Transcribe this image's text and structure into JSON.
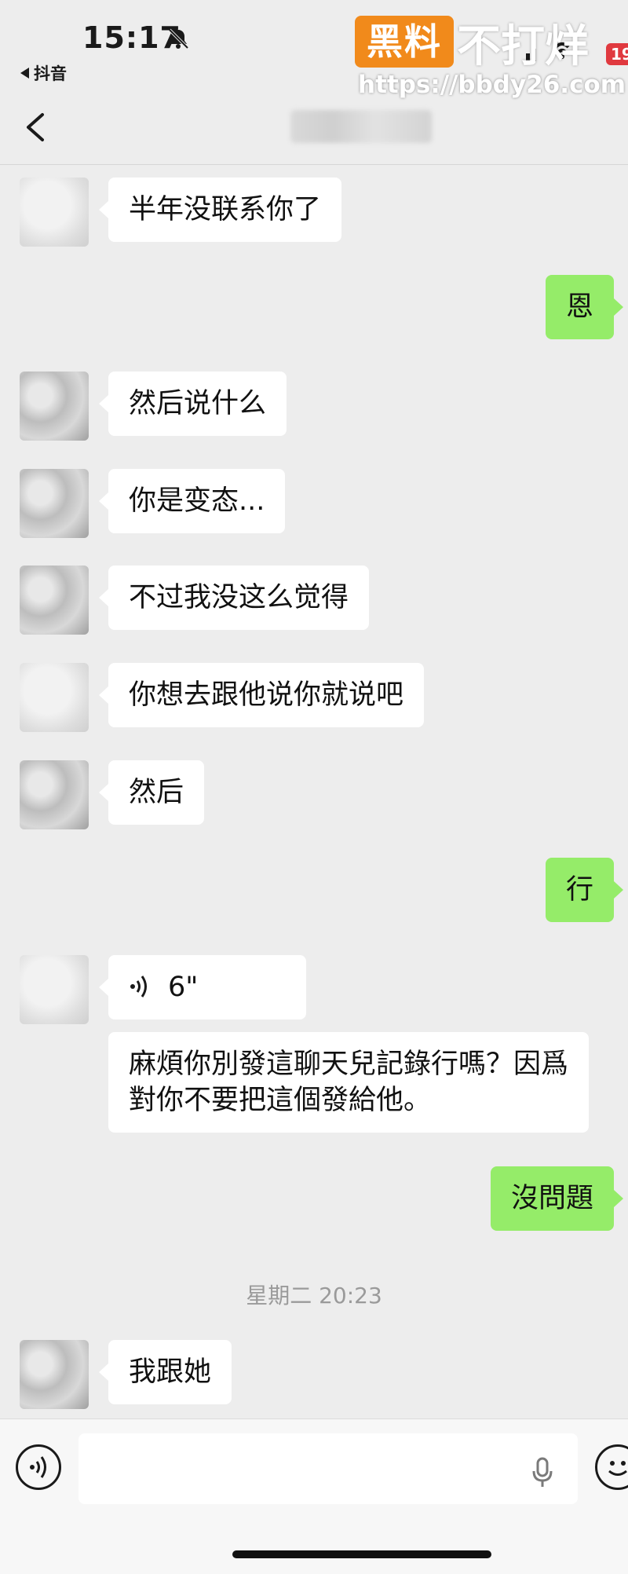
{
  "status_bar": {
    "time": "15:17",
    "back_app": "抖音",
    "battery": "19"
  },
  "watermark": {
    "logo": "黑料",
    "text": "不打烊",
    "url": "https://bbdy26.com"
  },
  "colors": {
    "background": "#ededed",
    "incoming_bubble": "#ffffff",
    "outgoing_bubble": "#95ec69",
    "watermark_orange": "#f18a1b",
    "battery_red": "#e0393f"
  },
  "messages": [
    {
      "side": "left",
      "text": "半年没联系你了"
    },
    {
      "side": "right",
      "text": "恩"
    },
    {
      "side": "left",
      "text": "然后说什么"
    },
    {
      "side": "left",
      "text": "你是变态..."
    },
    {
      "side": "left",
      "text": "不过我没这么觉得"
    },
    {
      "side": "left",
      "text": "你想去跟他说你就说吧"
    },
    {
      "side": "left",
      "text": "然后"
    },
    {
      "side": "right",
      "text": "行"
    },
    {
      "side": "left",
      "type": "voice",
      "text": "6\""
    },
    {
      "side": "left",
      "text": "麻煩你別發這聊天兒記錄行嗎？因爲對你不要把這個發給他。"
    },
    {
      "side": "right",
      "text": "沒問題"
    },
    {
      "side": "left",
      "text": "我跟她"
    }
  ],
  "timestamp": "星期二 20:23",
  "icons": {
    "nav_back": "chevron-left-icon",
    "voice_input": "voice-icon",
    "mic": "mic-icon",
    "emoji": "emoji-icon",
    "mute": "bell-slash-icon"
  }
}
